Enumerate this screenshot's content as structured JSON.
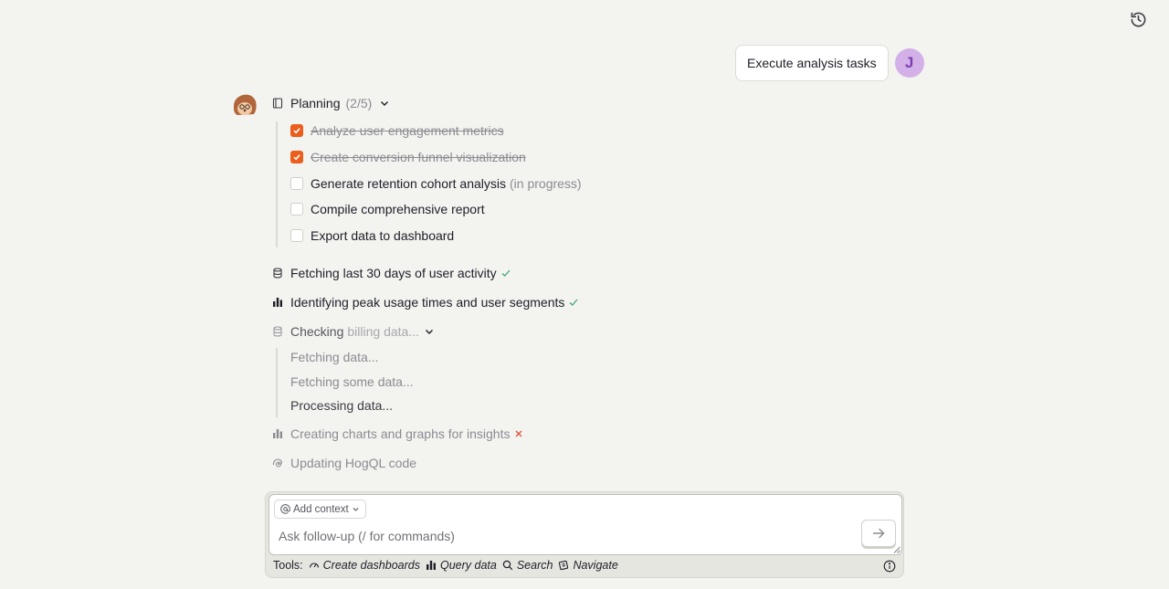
{
  "user_message": {
    "text": "Execute analysis tasks",
    "avatar_initial": "J",
    "avatar_color": "#d3b1e8"
  },
  "planning": {
    "label": "Planning",
    "progress": "(2/5)",
    "todos": [
      {
        "text": "Analyze user engagement metrics",
        "done": true,
        "note": ""
      },
      {
        "text": "Create conversion funnel visualization",
        "done": true,
        "note": ""
      },
      {
        "text": "Generate retention cohort analysis",
        "done": false,
        "note": "(in progress)"
      },
      {
        "text": "Compile comprehensive report",
        "done": false,
        "note": ""
      },
      {
        "text": "Export data to dashboard",
        "done": false,
        "note": ""
      }
    ]
  },
  "steps": {
    "fetching": {
      "text": "Fetching last 30 days of user activity",
      "status": "success",
      "icon": "database-icon"
    },
    "identifying": {
      "text": "Identifying peak usage times and user segments",
      "status": "success",
      "icon": "bar-chart-icon"
    },
    "checking": {
      "text": "Checking",
      "detail": "billing data...",
      "icon": "database-icon",
      "substeps": [
        "Fetching data...",
        "Fetching some data...",
        "Processing data..."
      ]
    },
    "charts": {
      "text": "Creating charts and graphs for insights",
      "status": "failed",
      "icon": "bar-chart-icon"
    },
    "hogql": {
      "text": "Updating HogQL code",
      "icon": "hedgehog-icon"
    }
  },
  "composer": {
    "add_context_label": "Add context",
    "placeholder": "Ask follow-up (/ for commands)",
    "tools_label": "Tools:",
    "tools": [
      "Create dashboards",
      "Query data",
      "Search",
      "Navigate"
    ]
  },
  "colors": {
    "accent": "#eb5e1b",
    "success": "#3aa670",
    "error": "#e0533d"
  }
}
